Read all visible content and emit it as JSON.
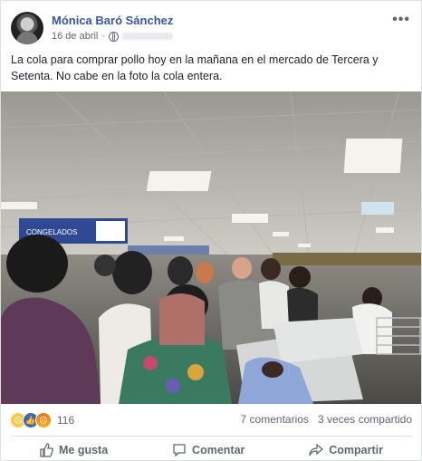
{
  "post": {
    "author": "Mónica Baró Sánchez",
    "date": "16 de abril",
    "text": "La cola para comprar pollo hoy en la mañana en el mercado de Tercera y Setenta. No cabe en la foto la cola entera."
  },
  "photo": {
    "sign_text": "CONGELADOS"
  },
  "stats": {
    "reaction_count": "116",
    "comments": "7 comentarios",
    "shares": "3 veces compartido",
    "reaction_icons": [
      "sad-icon",
      "like-icon",
      "angry-icon"
    ]
  },
  "actions": {
    "like": "Me gusta",
    "comment": "Comentar",
    "share": "Compartir"
  },
  "colors": {
    "author_link": "#365899",
    "text": "#1d2129",
    "secondary": "#606770",
    "like_blue": "#4267b2"
  }
}
